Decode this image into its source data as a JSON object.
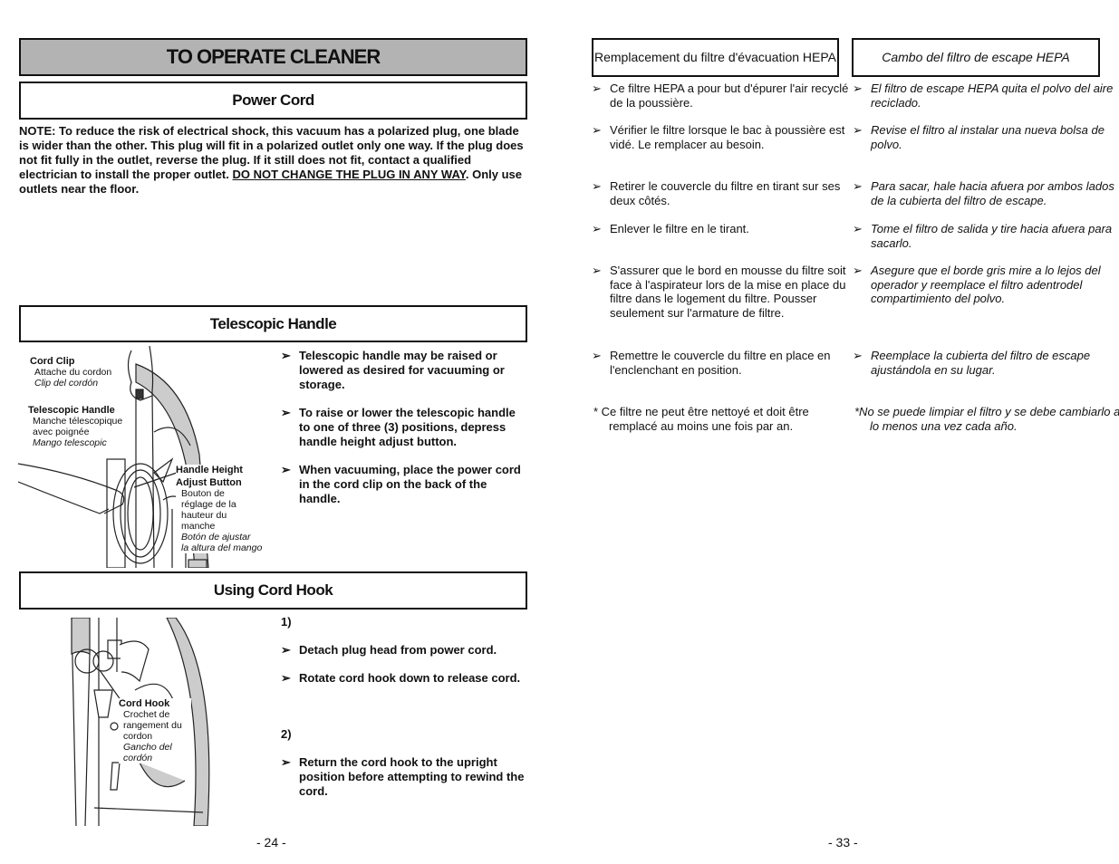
{
  "left_page": {
    "title": "TO OPERATE CLEANER",
    "power_cord": {
      "heading": "Power Cord",
      "note_prefix": "NOTE: To reduce the risk of electrical shock, this vacuum has a polarized plug, one blade is wider than the other. This plug will fit in a polarized outlet only one way. If the plug does not fit fully in the outlet, reverse the plug. If it still does not fit, contact a qualified electrician to install the proper outlet. ",
      "note_underlined": "DO NOT CHANGE THE PLUG IN ANY WAY",
      "note_suffix": ".  Only use outlets near the floor."
    },
    "telescopic_handle": {
      "heading": "Telescopic Handle",
      "labels": {
        "cord_clip": {
          "en": "Cord Clip",
          "fr": "Attache du cordon",
          "es": "Clip del cordón"
        },
        "telescopic_handle": {
          "en": "Telescopic Handle",
          "fr1": "Manche télescopique",
          "fr2": "avec poignée",
          "es": "Mango telescopic"
        },
        "height_button": {
          "en1": "Handle Height",
          "en2": "Adjust Button",
          "fr1": "Bouton de",
          "fr2": "réglage de la",
          "fr3": "hauteur du",
          "fr4": "manche",
          "es1": "Botón de ajustar",
          "es2": "la altura del mango"
        }
      },
      "bullets": [
        "Telescopic handle may be raised or lowered as desired for vacuuming or storage.",
        "To raise or lower the telescopic handle to one of three (3) positions, depress handle height adjust button.",
        "When vacuuming, place the power cord in the cord clip on the back of the handle."
      ]
    },
    "cord_hook": {
      "heading": "Using Cord Hook",
      "labels": {
        "en": "Cord Hook",
        "fr1": "Crochet de",
        "fr2": "rangement du",
        "fr3": "cordon",
        "es1": "Gancho del",
        "es2": "cordón"
      },
      "step1": "1)",
      "step1_bullets": [
        "Detach plug head from power cord.",
        "Rotate cord hook down to release cord."
      ],
      "step2": "2)",
      "step2_bullets": [
        "Return the cord hook to the upright position before attempting to rewind the cord."
      ]
    },
    "page_number": "- 24 -"
  },
  "right_page": {
    "french": {
      "heading": "Remplacement du filtre d'évacuation HEPA",
      "bullets": [
        "Ce filtre HEPA a pour but d'épurer l'air recyclé de la poussière.",
        "Vérifier le filtre lorsque le bac à poussière est vidé.  Le remplacer au besoin.",
        "Retirer le couvercle du filtre en tirant sur ses deux côtés.",
        "Enlever le filtre en le tirant.",
        "S'assurer que le bord en mousse du filtre soit face à l'aspirateur lors de la mise en place du filtre dans le logement du filtre. Pousser seulement sur l'armature de filtre.",
        "Remettre le couvercle du filtre en place en l'enclenchant en position."
      ],
      "footnote": "* Ce filtre ne peut être nettoyé et doit être remplacé au moins une fois par an."
    },
    "spanish": {
      "heading": "Cambo del filtro de escape HEPA",
      "bullets": [
        "El filtro de escape HEPA quita el polvo del aire reciclado.",
        "Revise el filtro al instalar una nueva bolsa de polvo.",
        "Para sacar, hale hacia afuera por ambos lados de la cubierta del filtro de escape.",
        "Tome el filtro de salida y tire hacia afuera para sacarlo.",
        "Asegure que el borde gris mire a lo lejos del operador y reemplace el filtro adentrodel compartimiento del polvo.",
        "Reemplace la cubierta del filtro de escape ajustándola en su lugar."
      ],
      "footnote": "*No se puede limpiar el filtro y se debe cambiarlo a lo menos una vez cada año."
    },
    "page_number": "- 33 -"
  },
  "bullet_glyph": "➢",
  "colors": {
    "title_bg": "#b3b3b3",
    "illustration_gray": "#cccccc"
  }
}
